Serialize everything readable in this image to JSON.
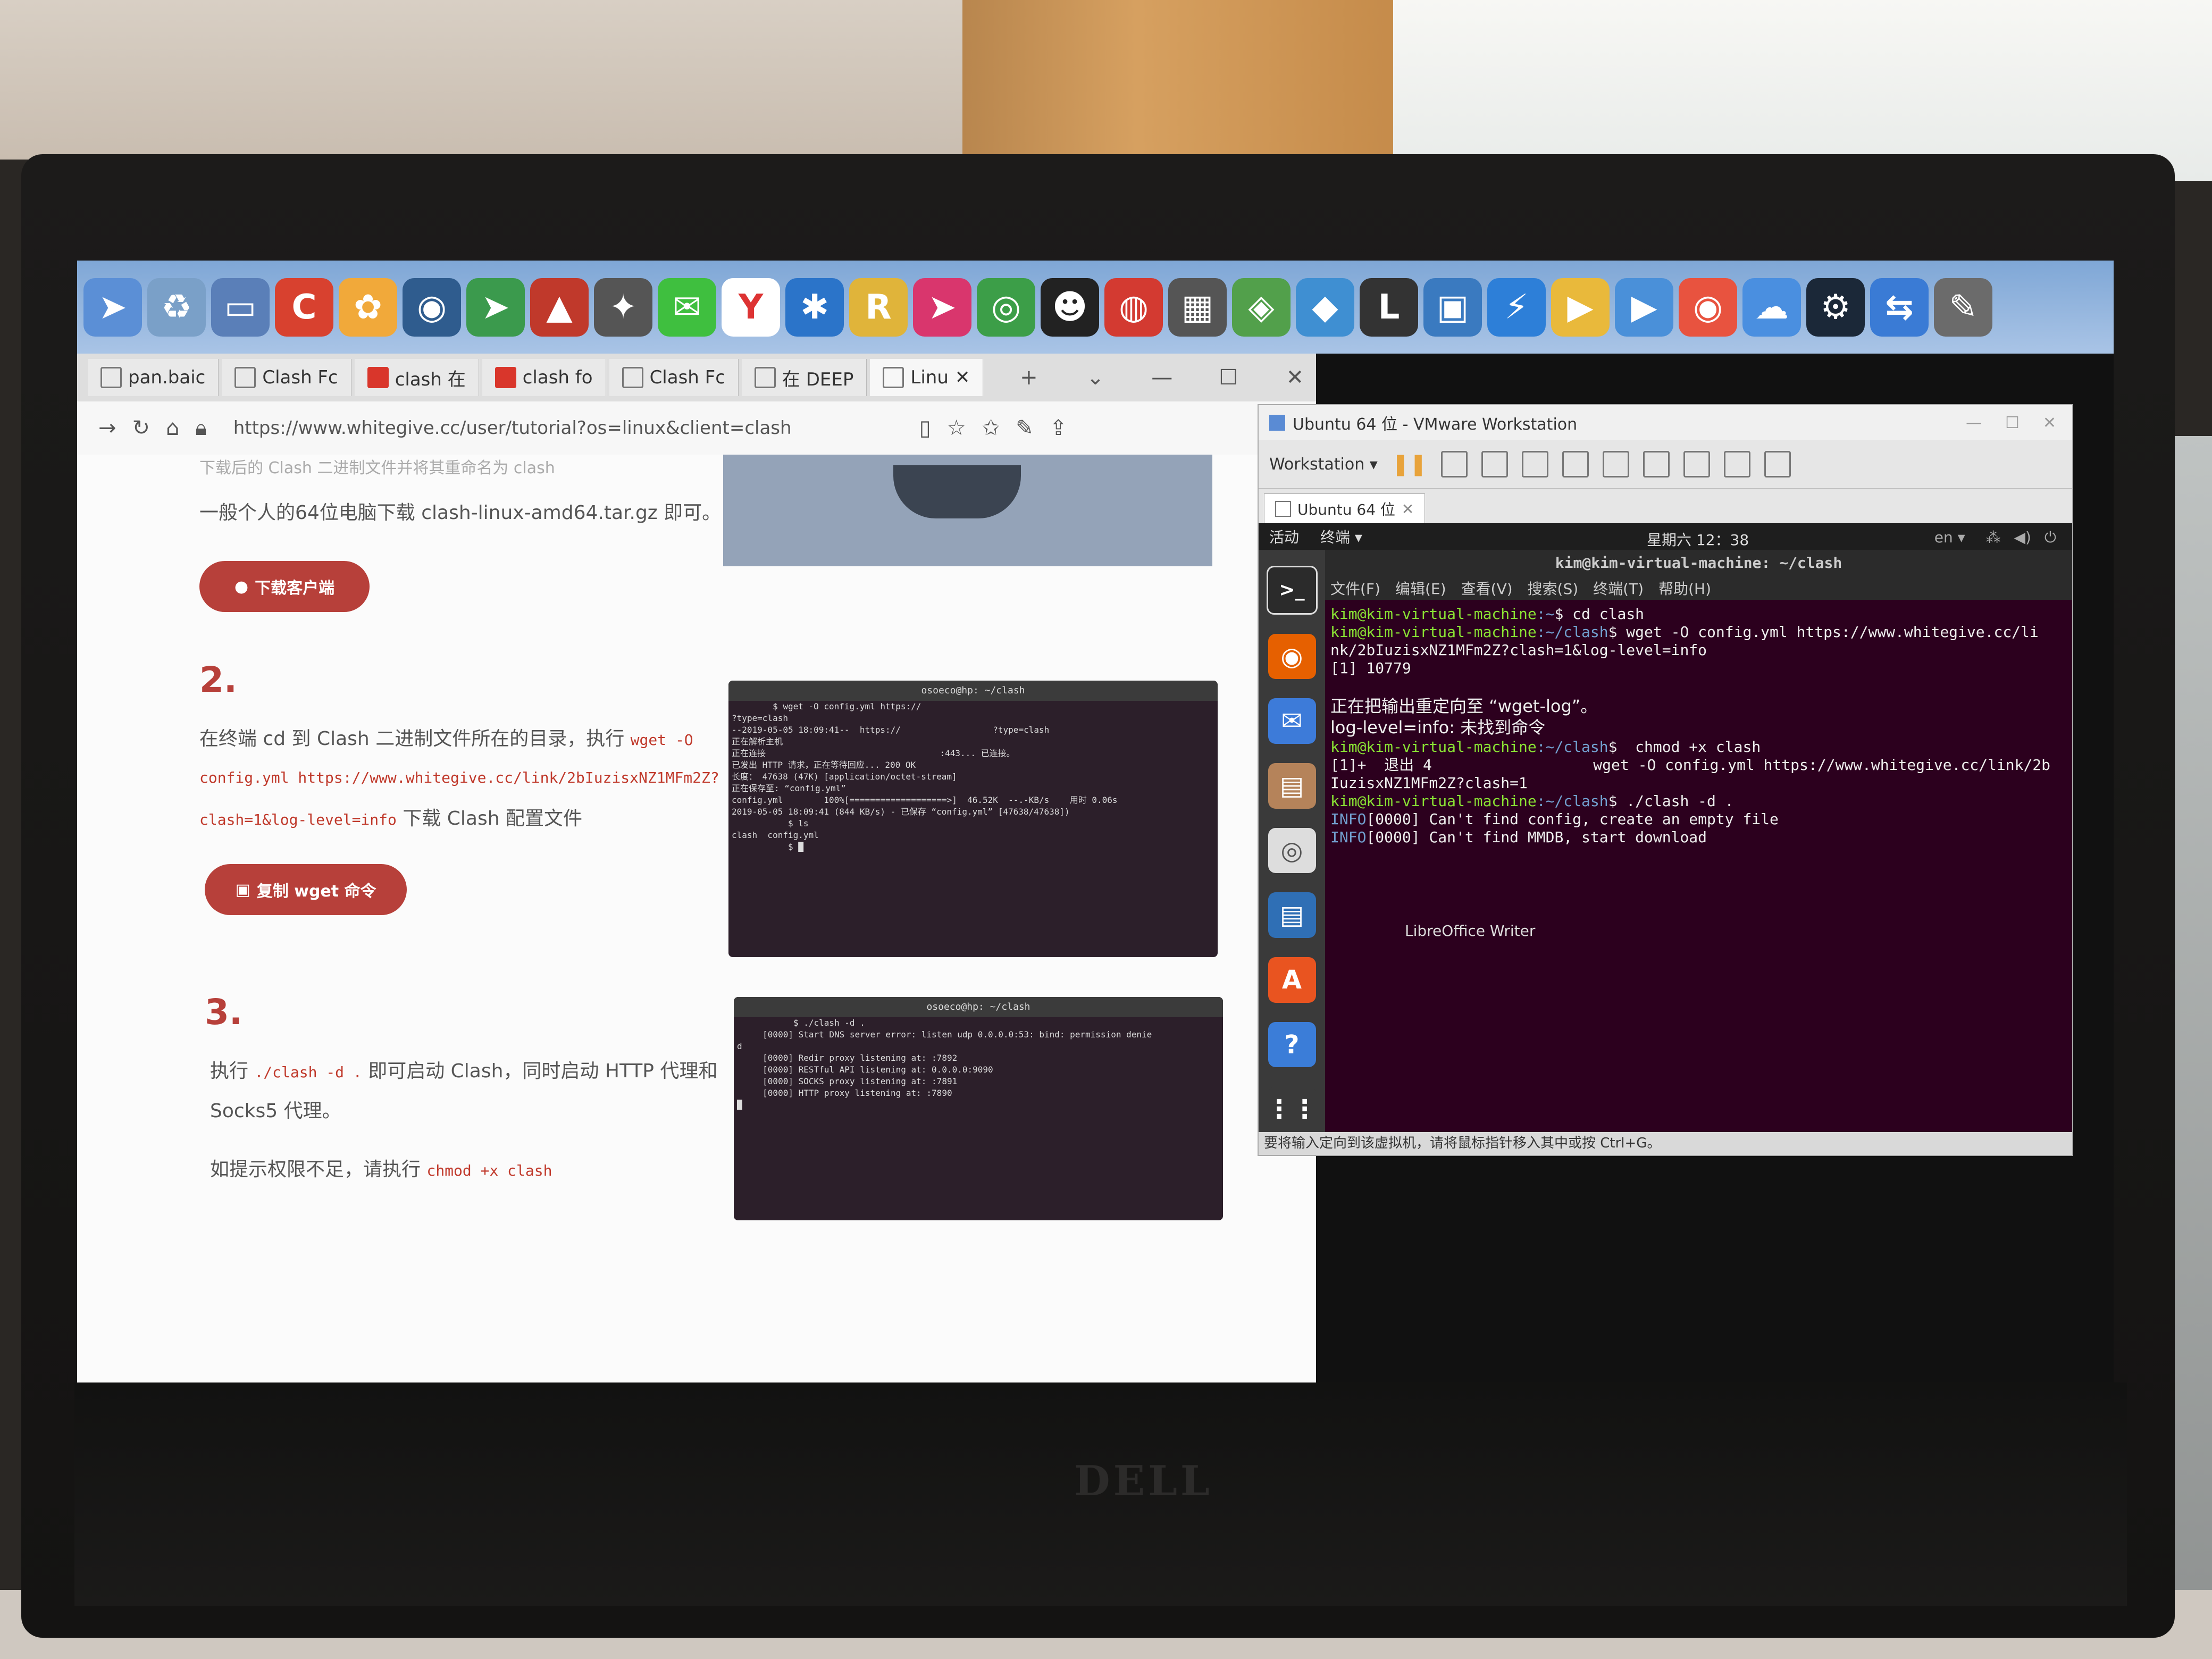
{
  "taskbar": {
    "icons": [
      {
        "name": "bird-app-icon",
        "color": "#5b8fd6",
        "glyph": "➤"
      },
      {
        "name": "recycle-bin-icon",
        "color": "#7aa0c8",
        "glyph": "♻"
      },
      {
        "name": "laptop-icon",
        "color": "#5a7fb8",
        "glyph": "▭"
      },
      {
        "name": "ccleaner-icon",
        "color": "#d8412f",
        "glyph": "C"
      },
      {
        "name": "butterfly-icon",
        "color": "#f1a93a",
        "glyph": "✿"
      },
      {
        "name": "eagle-icon",
        "color": "#2f5c8e",
        "glyph": "◉"
      },
      {
        "name": "arrow-app-icon",
        "color": "#3b9a4d",
        "glyph": "➤"
      },
      {
        "name": "red-mountain-icon",
        "color": "#c0392b",
        "glyph": "▲"
      },
      {
        "name": "star-app-icon",
        "color": "#555555",
        "glyph": "✦"
      },
      {
        "name": "wechat-icon",
        "color": "#3fbf3f",
        "glyph": "✉"
      },
      {
        "name": "yandex-icon",
        "color": "#ffffff",
        "glyph": "Y"
      },
      {
        "name": "network-icon",
        "color": "#2b74c9",
        "glyph": "✱"
      },
      {
        "name": "r-app-icon",
        "color": "#e0b43a",
        "glyph": "R"
      },
      {
        "name": "paper-plane-icon",
        "color": "#d9366d",
        "glyph": "➤"
      },
      {
        "name": "chrome-icon",
        "color": "#3c9e48",
        "glyph": "◎"
      },
      {
        "name": "qq-icon",
        "color": "#222222",
        "glyph": "☻"
      },
      {
        "name": "netease-music-icon",
        "color": "#d33a31",
        "glyph": "◍"
      },
      {
        "name": "image-tool-icon",
        "color": "#555555",
        "glyph": "▦"
      },
      {
        "name": "game-app-icon",
        "color": "#52a04b",
        "glyph": "◈"
      },
      {
        "name": "kite-icon",
        "color": "#3f8fd2",
        "glyph": "◆"
      },
      {
        "name": "l-app-icon",
        "color": "#333333",
        "glyph": "L"
      },
      {
        "name": "video-recorder-icon",
        "color": "#3a7ac0",
        "glyph": "▣"
      },
      {
        "name": "thunder-icon",
        "color": "#2d7fd8",
        "glyph": "⚡"
      },
      {
        "name": "vmware-player-icon",
        "color": "#e9b93b",
        "glyph": "▶"
      },
      {
        "name": "media-player-icon",
        "color": "#4a90d9",
        "glyph": "▶"
      },
      {
        "name": "weibo-icon",
        "color": "#e8533f",
        "glyph": "◉"
      },
      {
        "name": "baidu-netdisk-icon",
        "color": "#4a8fe0",
        "glyph": "☁"
      },
      {
        "name": "steam-icon",
        "color": "#1b2838",
        "glyph": "⚙"
      },
      {
        "name": "remote-desktop-icon",
        "color": "#3a7bd5",
        "glyph": "⇆"
      },
      {
        "name": "tools-icon",
        "color": "#6b6b6b",
        "glyph": "✎"
      }
    ]
  },
  "browser": {
    "tabs": [
      {
        "label": "pan.baic",
        "favicon": "baidu"
      },
      {
        "label": "Clash Fc",
        "favicon": "page"
      },
      {
        "label": "clash 在",
        "favicon": "red"
      },
      {
        "label": "clash fo",
        "favicon": "red"
      },
      {
        "label": "Clash Fc",
        "favicon": "page"
      },
      {
        "label": "在 DEEP",
        "favicon": "page"
      },
      {
        "label": "Linu",
        "favicon": "page"
      }
    ],
    "url": "https://www.whitegive.cc/user/tutorial?os=linux&client=clash",
    "page": {
      "cut_line": "下载后的 Clash 二进制文件并将其重命名为 clash",
      "line1": "一般个人的64位电脑下载 clash-linux-amd64.tar.gz 即可。",
      "download_button": "下载客户端",
      "step2_num": "2.",
      "step2_text_a": "在终端 cd 到 Clash 二进制文件所在的目录，执行",
      "step2_code_a": "wget -O",
      "step2_code_b": "config.yml https://www.whitegive.cc/link/2bIuzisxNZ1MFm2Z?",
      "step2_code_c": "clash=1&log-level=info",
      "step2_text_b": "下载 Clash 配置文件",
      "copy_button": "复制 wget 命令",
      "step3_num": "3.",
      "step3_text_a": "执行",
      "step3_code": "./clash -d .",
      "step3_text_b": "即可启动 Clash，同时启动 HTTP 代理和",
      "step3_text_c": "Socks5 代理。",
      "perm_text": "如提示权限不足，请执行",
      "perm_code": "chmod +x clash"
    },
    "shot1": {
      "title": "osoeco@hp: ~/clash",
      "lines": [
        "        $ wget -O config.yml https://",
        "?type=clash",
        "--2019-05-05 18:09:41--  https://                  ?type=clash",
        "正在解析主机",
        "正在连接                                  :443... 已连接。",
        "已发出 HTTP 请求，正在等待回应... 200 OK",
        "长度： 47638 (47K) [application/octet-stream]",
        "正在保存至: “config.yml”",
        "",
        "config.yml        100%[===================>]  46.52K  --.-KB/s    用时 0.06s",
        "",
        "2019-05-05 18:09:41 (844 KB/s) - 已保存 “config.yml” [47638/47638])",
        "",
        "           $ ls",
        "clash  config.yml",
        "           $ █"
      ]
    },
    "shot2": {
      "title": "osoeco@hp: ~/clash",
      "lines": [
        "           $ ./clash -d .",
        "     [0000] Start DNS server error: listen udp 0.0.0.0:53: bind: permission denie",
        "d",
        "     [0000] Redir proxy listening at: :7892",
        "     [0000] RESTful API listening at: 0.0.0.0:9090",
        "     [0000] SOCKS proxy listening at: :7891",
        "     [0000] HTTP proxy listening at: :7890",
        "█"
      ]
    }
  },
  "vmware": {
    "title": "Ubuntu 64 位 - VMware Workstation",
    "workstation_menu": "Workstation ▾",
    "vm_tab": "Ubuntu 64 位",
    "status_bar": "要将输入定向到该虚拟机，请将鼠标指针移入其中或按 Ctrl+G。",
    "ubuntu": {
      "activities": "活动",
      "terminal_menu": "终端 ▾",
      "clock": "星期六 12：38",
      "lang": "en ▾",
      "terminal_title": "kim@kim-virtual-machine: ~/clash",
      "menu": [
        "文件(F)",
        "编辑(E)",
        "查看(V)",
        "搜索(S)",
        "终端(T)",
        "帮助(H)"
      ],
      "tooltip": "LibreOffice Writer",
      "lines": [
        {
          "user": "kim@kim-virtual-machine",
          "path": ":~",
          "cmd": "$ cd clash"
        },
        {
          "user": "kim@kim-virtual-machine",
          "path": ":~/clash",
          "cmd": "$ wget -O config.yml https://www.whitegive.cc/li"
        },
        {
          "text": "nk/2bIuzisxNZ1MFm2Z?clash=1&log-level=info"
        },
        {
          "text": "[1] 10779"
        },
        {
          "text": ""
        },
        {
          "cn": "正在把输出重定向至 “wget-log”。"
        },
        {
          "cn": "log-level=info: 未找到命令"
        },
        {
          "user": "kim@kim-virtual-machine",
          "path": ":~/clash",
          "cmd": "$  chmod +x clash"
        },
        {
          "text": "[1]+  退出 4                  wget -O config.yml https://www.whitegive.cc/link/2b"
        },
        {
          "text": "IuzisxNZ1MFm2Z?clash=1"
        },
        {
          "user": "kim@kim-virtual-machine",
          "path": ":~/clash",
          "cmd": "$ ./clash -d ."
        },
        {
          "info": "INFO",
          "text": "[0000] Can't find config, create an empty file"
        },
        {
          "info": "INFO",
          "text": "[0000] Can't find MMDB, start download"
        }
      ]
    },
    "dock": [
      {
        "name": "terminal-icon",
        "color": "#2b2b2b",
        "glyph": ">_"
      },
      {
        "name": "firefox-icon",
        "color": "#e66000",
        "glyph": "◉"
      },
      {
        "name": "thunderbird-icon",
        "color": "#3d7bd9",
        "glyph": "✉"
      },
      {
        "name": "files-icon",
        "color": "#b5835a",
        "glyph": "▤"
      },
      {
        "name": "rhythmbox-icon",
        "color": "#dddddd",
        "glyph": "◎"
      },
      {
        "name": "libreoffice-writer-icon",
        "color": "#2f6fb5",
        "glyph": "▤"
      },
      {
        "name": "software-center-icon",
        "color": "#e95420",
        "glyph": "A"
      },
      {
        "name": "help-icon",
        "color": "#3b7dd8",
        "glyph": "?"
      },
      {
        "name": "show-apps-icon",
        "color": "#3a3a3a",
        "glyph": "⋮⋮"
      }
    ]
  },
  "hardware": {
    "logo": "DELL"
  }
}
